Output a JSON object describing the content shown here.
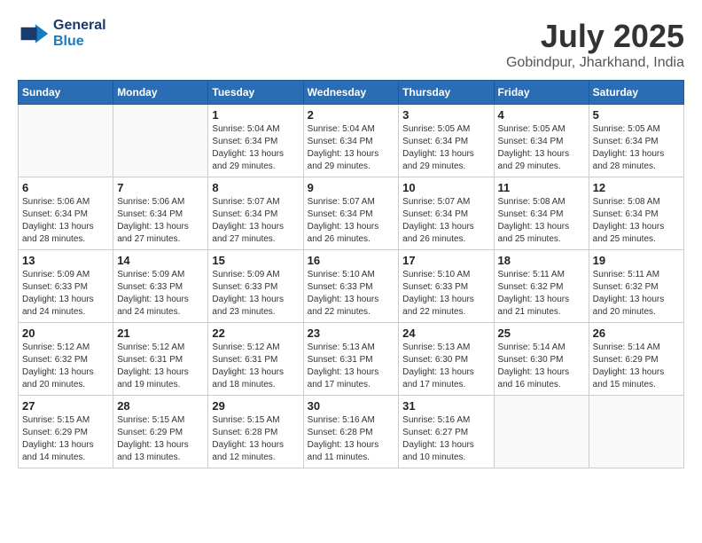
{
  "header": {
    "logo_line1": "General",
    "logo_line2": "Blue",
    "month_year": "July 2025",
    "location": "Gobindpur, Jharkhand, India"
  },
  "weekdays": [
    "Sunday",
    "Monday",
    "Tuesday",
    "Wednesday",
    "Thursday",
    "Friday",
    "Saturday"
  ],
  "weeks": [
    [
      {
        "day": "",
        "sunrise": "",
        "sunset": "",
        "daylight": ""
      },
      {
        "day": "",
        "sunrise": "",
        "sunset": "",
        "daylight": ""
      },
      {
        "day": "1",
        "sunrise": "Sunrise: 5:04 AM",
        "sunset": "Sunset: 6:34 PM",
        "daylight": "Daylight: 13 hours and 29 minutes."
      },
      {
        "day": "2",
        "sunrise": "Sunrise: 5:04 AM",
        "sunset": "Sunset: 6:34 PM",
        "daylight": "Daylight: 13 hours and 29 minutes."
      },
      {
        "day": "3",
        "sunrise": "Sunrise: 5:05 AM",
        "sunset": "Sunset: 6:34 PM",
        "daylight": "Daylight: 13 hours and 29 minutes."
      },
      {
        "day": "4",
        "sunrise": "Sunrise: 5:05 AM",
        "sunset": "Sunset: 6:34 PM",
        "daylight": "Daylight: 13 hours and 29 minutes."
      },
      {
        "day": "5",
        "sunrise": "Sunrise: 5:05 AM",
        "sunset": "Sunset: 6:34 PM",
        "daylight": "Daylight: 13 hours and 28 minutes."
      }
    ],
    [
      {
        "day": "6",
        "sunrise": "Sunrise: 5:06 AM",
        "sunset": "Sunset: 6:34 PM",
        "daylight": "Daylight: 13 hours and 28 minutes."
      },
      {
        "day": "7",
        "sunrise": "Sunrise: 5:06 AM",
        "sunset": "Sunset: 6:34 PM",
        "daylight": "Daylight: 13 hours and 27 minutes."
      },
      {
        "day": "8",
        "sunrise": "Sunrise: 5:07 AM",
        "sunset": "Sunset: 6:34 PM",
        "daylight": "Daylight: 13 hours and 27 minutes."
      },
      {
        "day": "9",
        "sunrise": "Sunrise: 5:07 AM",
        "sunset": "Sunset: 6:34 PM",
        "daylight": "Daylight: 13 hours and 26 minutes."
      },
      {
        "day": "10",
        "sunrise": "Sunrise: 5:07 AM",
        "sunset": "Sunset: 6:34 PM",
        "daylight": "Daylight: 13 hours and 26 minutes."
      },
      {
        "day": "11",
        "sunrise": "Sunrise: 5:08 AM",
        "sunset": "Sunset: 6:34 PM",
        "daylight": "Daylight: 13 hours and 25 minutes."
      },
      {
        "day": "12",
        "sunrise": "Sunrise: 5:08 AM",
        "sunset": "Sunset: 6:34 PM",
        "daylight": "Daylight: 13 hours and 25 minutes."
      }
    ],
    [
      {
        "day": "13",
        "sunrise": "Sunrise: 5:09 AM",
        "sunset": "Sunset: 6:33 PM",
        "daylight": "Daylight: 13 hours and 24 minutes."
      },
      {
        "day": "14",
        "sunrise": "Sunrise: 5:09 AM",
        "sunset": "Sunset: 6:33 PM",
        "daylight": "Daylight: 13 hours and 24 minutes."
      },
      {
        "day": "15",
        "sunrise": "Sunrise: 5:09 AM",
        "sunset": "Sunset: 6:33 PM",
        "daylight": "Daylight: 13 hours and 23 minutes."
      },
      {
        "day": "16",
        "sunrise": "Sunrise: 5:10 AM",
        "sunset": "Sunset: 6:33 PM",
        "daylight": "Daylight: 13 hours and 22 minutes."
      },
      {
        "day": "17",
        "sunrise": "Sunrise: 5:10 AM",
        "sunset": "Sunset: 6:33 PM",
        "daylight": "Daylight: 13 hours and 22 minutes."
      },
      {
        "day": "18",
        "sunrise": "Sunrise: 5:11 AM",
        "sunset": "Sunset: 6:32 PM",
        "daylight": "Daylight: 13 hours and 21 minutes."
      },
      {
        "day": "19",
        "sunrise": "Sunrise: 5:11 AM",
        "sunset": "Sunset: 6:32 PM",
        "daylight": "Daylight: 13 hours and 20 minutes."
      }
    ],
    [
      {
        "day": "20",
        "sunrise": "Sunrise: 5:12 AM",
        "sunset": "Sunset: 6:32 PM",
        "daylight": "Daylight: 13 hours and 20 minutes."
      },
      {
        "day": "21",
        "sunrise": "Sunrise: 5:12 AM",
        "sunset": "Sunset: 6:31 PM",
        "daylight": "Daylight: 13 hours and 19 minutes."
      },
      {
        "day": "22",
        "sunrise": "Sunrise: 5:12 AM",
        "sunset": "Sunset: 6:31 PM",
        "daylight": "Daylight: 13 hours and 18 minutes."
      },
      {
        "day": "23",
        "sunrise": "Sunrise: 5:13 AM",
        "sunset": "Sunset: 6:31 PM",
        "daylight": "Daylight: 13 hours and 17 minutes."
      },
      {
        "day": "24",
        "sunrise": "Sunrise: 5:13 AM",
        "sunset": "Sunset: 6:30 PM",
        "daylight": "Daylight: 13 hours and 17 minutes."
      },
      {
        "day": "25",
        "sunrise": "Sunrise: 5:14 AM",
        "sunset": "Sunset: 6:30 PM",
        "daylight": "Daylight: 13 hours and 16 minutes."
      },
      {
        "day": "26",
        "sunrise": "Sunrise: 5:14 AM",
        "sunset": "Sunset: 6:29 PM",
        "daylight": "Daylight: 13 hours and 15 minutes."
      }
    ],
    [
      {
        "day": "27",
        "sunrise": "Sunrise: 5:15 AM",
        "sunset": "Sunset: 6:29 PM",
        "daylight": "Daylight: 13 hours and 14 minutes."
      },
      {
        "day": "28",
        "sunrise": "Sunrise: 5:15 AM",
        "sunset": "Sunset: 6:29 PM",
        "daylight": "Daylight: 13 hours and 13 minutes."
      },
      {
        "day": "29",
        "sunrise": "Sunrise: 5:15 AM",
        "sunset": "Sunset: 6:28 PM",
        "daylight": "Daylight: 13 hours and 12 minutes."
      },
      {
        "day": "30",
        "sunrise": "Sunrise: 5:16 AM",
        "sunset": "Sunset: 6:28 PM",
        "daylight": "Daylight: 13 hours and 11 minutes."
      },
      {
        "day": "31",
        "sunrise": "Sunrise: 5:16 AM",
        "sunset": "Sunset: 6:27 PM",
        "daylight": "Daylight: 13 hours and 10 minutes."
      },
      {
        "day": "",
        "sunrise": "",
        "sunset": "",
        "daylight": ""
      },
      {
        "day": "",
        "sunrise": "",
        "sunset": "",
        "daylight": ""
      }
    ]
  ]
}
